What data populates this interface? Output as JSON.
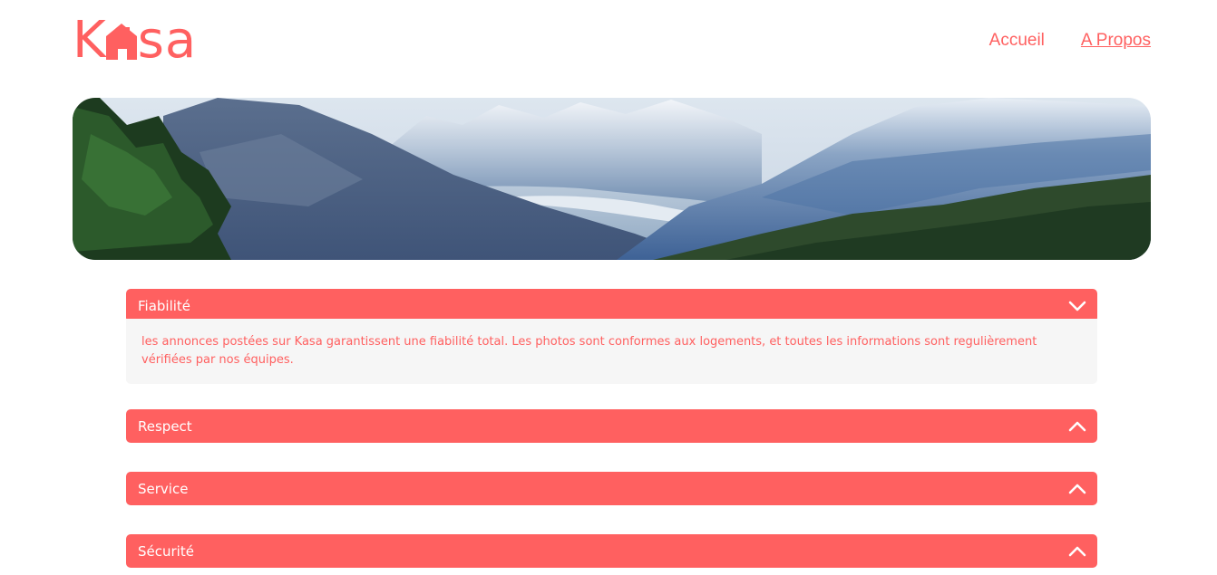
{
  "brand": {
    "logo_text_left": "K",
    "logo_text_right": "sa",
    "logo_icon": "house-icon",
    "accent_color": "#ff6060"
  },
  "nav": {
    "items": [
      {
        "label": "Accueil",
        "active": false
      },
      {
        "label": "A Propos",
        "active": true
      }
    ]
  },
  "banner": {
    "image": "mountain-landscape"
  },
  "accordions": [
    {
      "title": "Fiabilité",
      "open": true,
      "icon": "chevron-down-icon",
      "content": "les annonces postées sur Kasa garantissent une fiabilité total. Les photos sont conformes aux logements, et toutes les informations sont regulièrement vérifiées par nos équipes."
    },
    {
      "title": "Respect",
      "open": false,
      "icon": "chevron-up-icon",
      "content": ""
    },
    {
      "title": "Service",
      "open": false,
      "icon": "chevron-up-icon",
      "content": ""
    },
    {
      "title": "Sécurité",
      "open": false,
      "icon": "chevron-up-icon",
      "content": ""
    }
  ]
}
